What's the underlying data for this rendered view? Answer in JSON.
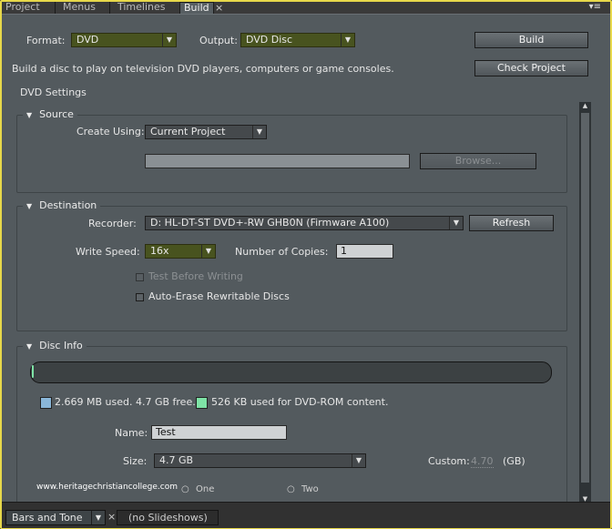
{
  "tabs": [
    {
      "label": "Project"
    },
    {
      "label": "Menus"
    },
    {
      "label": "Timelines"
    },
    {
      "label": "Build"
    }
  ],
  "tab_close": "×",
  "panel_menu": "▾≡",
  "top": {
    "format_label": "Format:",
    "format_value": "DVD",
    "output_label": "Output:",
    "output_value": "DVD Disc",
    "build_button": "Build",
    "check_button": "Check Project",
    "description": "Build a disc to play on television DVD players, computers or game consoles.",
    "settings_heading": "DVD Settings"
  },
  "source": {
    "title": "Source",
    "create_using_label": "Create Using:",
    "create_using_value": "Current Project",
    "path_value": "",
    "browse_button": "Browse..."
  },
  "destination": {
    "title": "Destination",
    "recorder_label": "Recorder:",
    "recorder_value": "D: HL-DT-ST DVD+-RW GHB0N (Firmware A100)",
    "refresh_button": "Refresh",
    "write_speed_label": "Write Speed:",
    "write_speed_value": "16x",
    "copies_label": "Number of Copies:",
    "copies_value": "1",
    "test_before_writing": "Test Before Writing",
    "auto_erase": "Auto-Erase Rewritable Discs"
  },
  "disc_info": {
    "title": "Disc Info",
    "used_text": "2.669 MB used.  4.7 GB free.",
    "rom_text": "526 KB used for DVD-ROM content.",
    "used_color": "#8ab7d9",
    "rom_color": "#7ee3a6",
    "name_label": "Name:",
    "name_value": "Test",
    "size_label": "Size:",
    "size_value": "4.7 GB",
    "custom_label": "Custom:",
    "custom_value": "4.70",
    "custom_unit": "(GB)",
    "layer_one": "One",
    "layer_two": "Two"
  },
  "watermark": "www.heritagechristiancollege.com",
  "bottom": {
    "tab1": "Bars and Tone",
    "tab1_close": "×",
    "tab2": "(no Slideshows)"
  },
  "colors": {
    "highlight": "#e7d84a",
    "panel_bg": "#535a5e",
    "dropdown_highlight": "#48531f"
  }
}
